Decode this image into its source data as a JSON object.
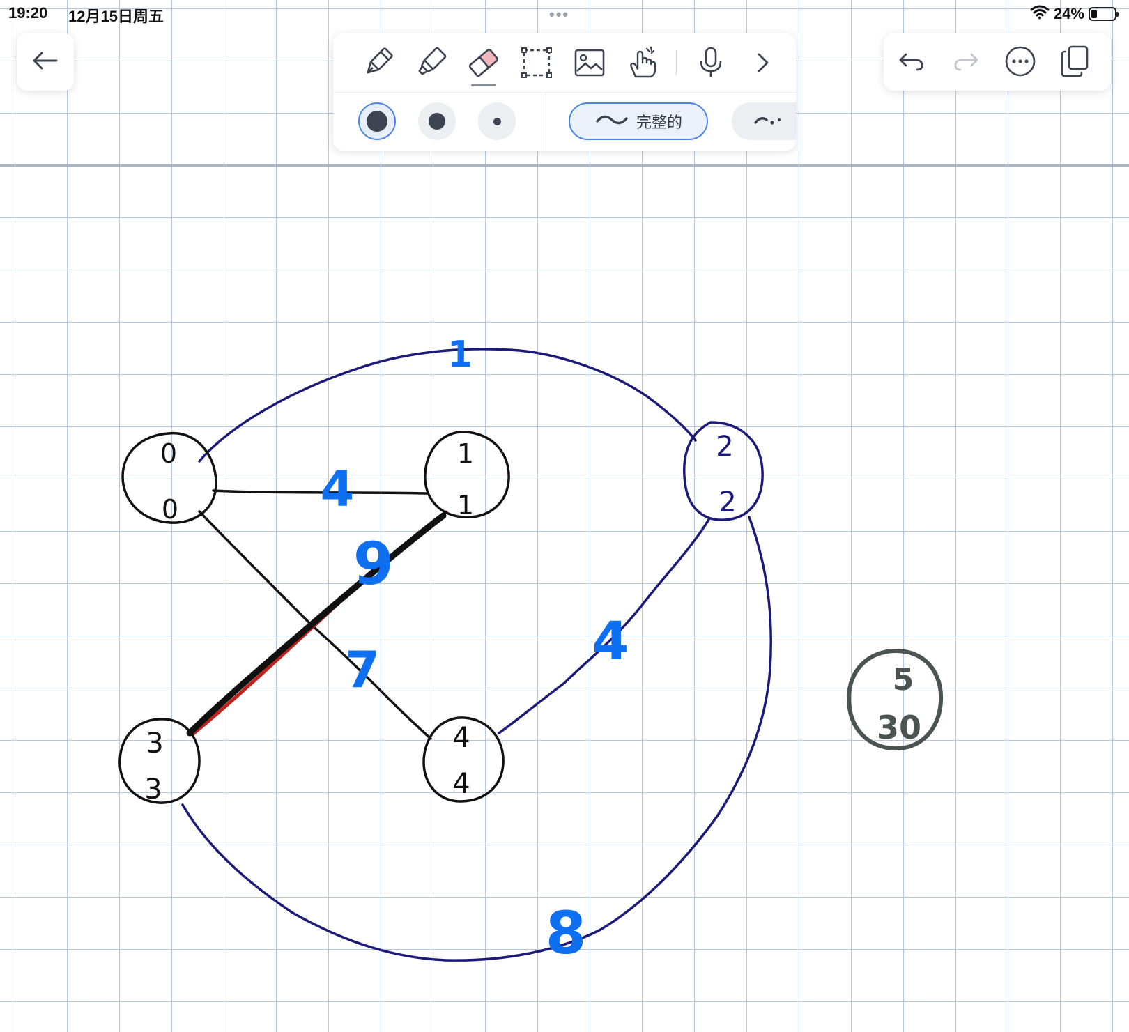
{
  "status_bar": {
    "time": "19:20",
    "date": "12月15日周五",
    "dots": "•••",
    "battery_percent": "24%",
    "battery_level": 0.24
  },
  "toolbar": {
    "tools": [
      {
        "name": "fountain-pen-icon"
      },
      {
        "name": "highlighter-icon"
      },
      {
        "name": "eraser-icon",
        "selected": true
      },
      {
        "name": "lasso-select-icon"
      },
      {
        "name": "image-icon"
      },
      {
        "name": "hand-touch-icon"
      },
      {
        "name": "microphone-icon"
      },
      {
        "name": "chevron-right-icon"
      }
    ],
    "size_options": [
      "large",
      "medium",
      "small"
    ],
    "selected_size": "large",
    "stroke_style_label": "完整的"
  },
  "right_controls": [
    "undo-icon",
    "redo-icon",
    "more-icon",
    "pages-icon"
  ],
  "colors": {
    "grid": "#b6c8e0",
    "ink_black": "#111111",
    "ink_navy": "#1c1a78",
    "ink_blue": "#0e6ff0",
    "ink_red": "#c0221e",
    "ink_grey": "#4a5553",
    "accent": "#4a86e8"
  },
  "drawing": {
    "nodes": [
      {
        "id": "node-0",
        "top": "0",
        "bottom": "0"
      },
      {
        "id": "node-1",
        "top": "1",
        "bottom": "1"
      },
      {
        "id": "node-2",
        "top": "2",
        "bottom": "2"
      },
      {
        "id": "node-3",
        "top": "3",
        "bottom": "3"
      },
      {
        "id": "node-4",
        "top": "4",
        "bottom": "4"
      },
      {
        "id": "node-5",
        "top": "5",
        "bottom": "30"
      }
    ],
    "edge_weights": {
      "e0_1": "4",
      "e0_2": "1",
      "e1_3": "9",
      "e0_4": "7",
      "e2_4": "4",
      "e3_2": "8"
    }
  }
}
